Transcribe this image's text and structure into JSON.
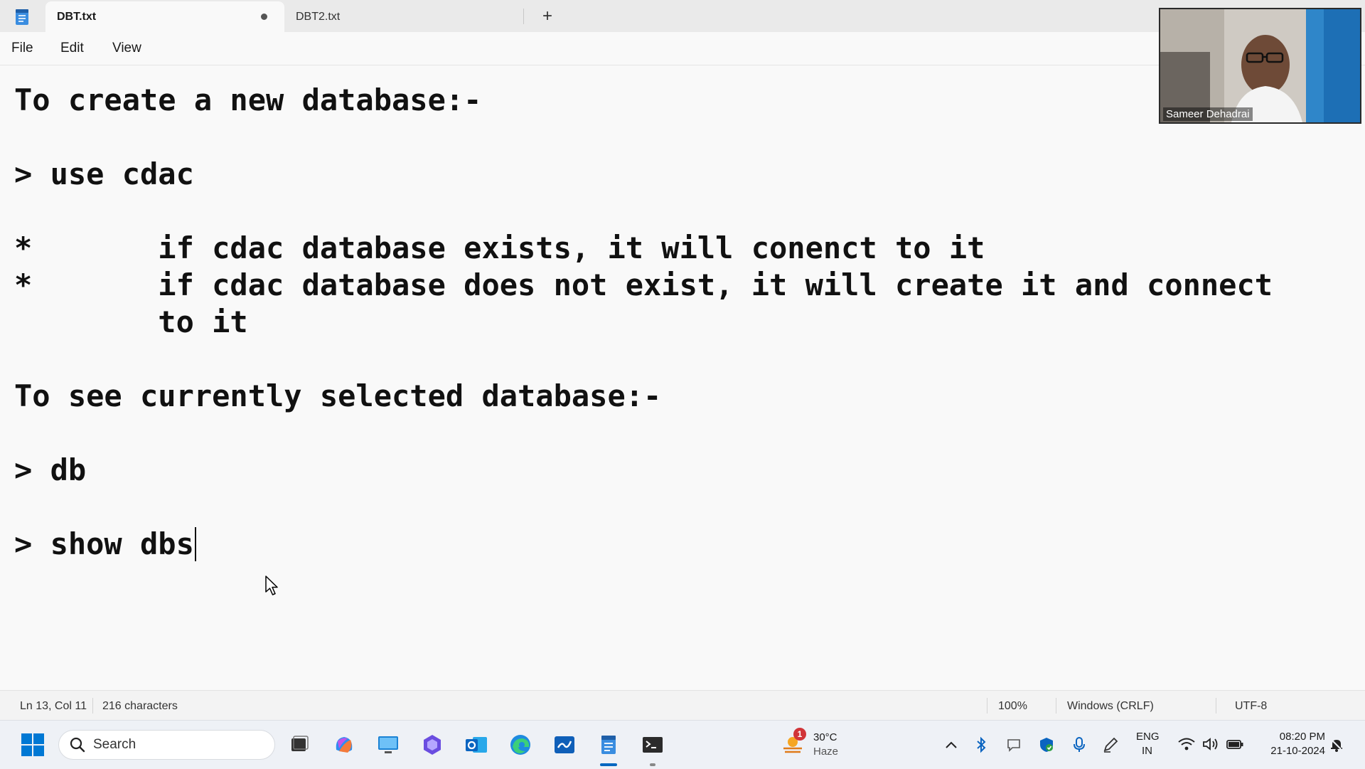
{
  "tabs": [
    {
      "label": "DBT.txt",
      "active": true,
      "unsaved": true
    },
    {
      "label": "DBT2.txt",
      "active": false
    }
  ],
  "new_tab_label": "+",
  "menu": [
    "File",
    "Edit",
    "View"
  ],
  "editor": {
    "lines": [
      "To create a new database:-",
      "> use cdac",
      "*       if cdac database exists, it will conenct to it",
      "*       if cdac database does not exist, it will create it and connect",
      "        to it",
      "To see currently selected database:-",
      "> db",
      "> show dbs"
    ]
  },
  "status": {
    "position": "Ln 13, Col 11",
    "characters": "216 characters",
    "zoom": "100%",
    "line_ending": "Windows (CRLF)",
    "encoding": "UTF-8"
  },
  "video": {
    "participant_name": "Sameer Dehadrai"
  },
  "taskbar": {
    "search_label": "Search",
    "weather": {
      "temp": "30°C",
      "condition": "Haze",
      "badge": "1"
    },
    "language": {
      "lang": "ENG",
      "region": "IN"
    },
    "clock": {
      "time": "08:20 PM",
      "date": "21-10-2024"
    }
  },
  "colors": {
    "accent": "#0067c0",
    "titlebar": "#eaeaea",
    "editor_bg": "#f9f9f9"
  }
}
